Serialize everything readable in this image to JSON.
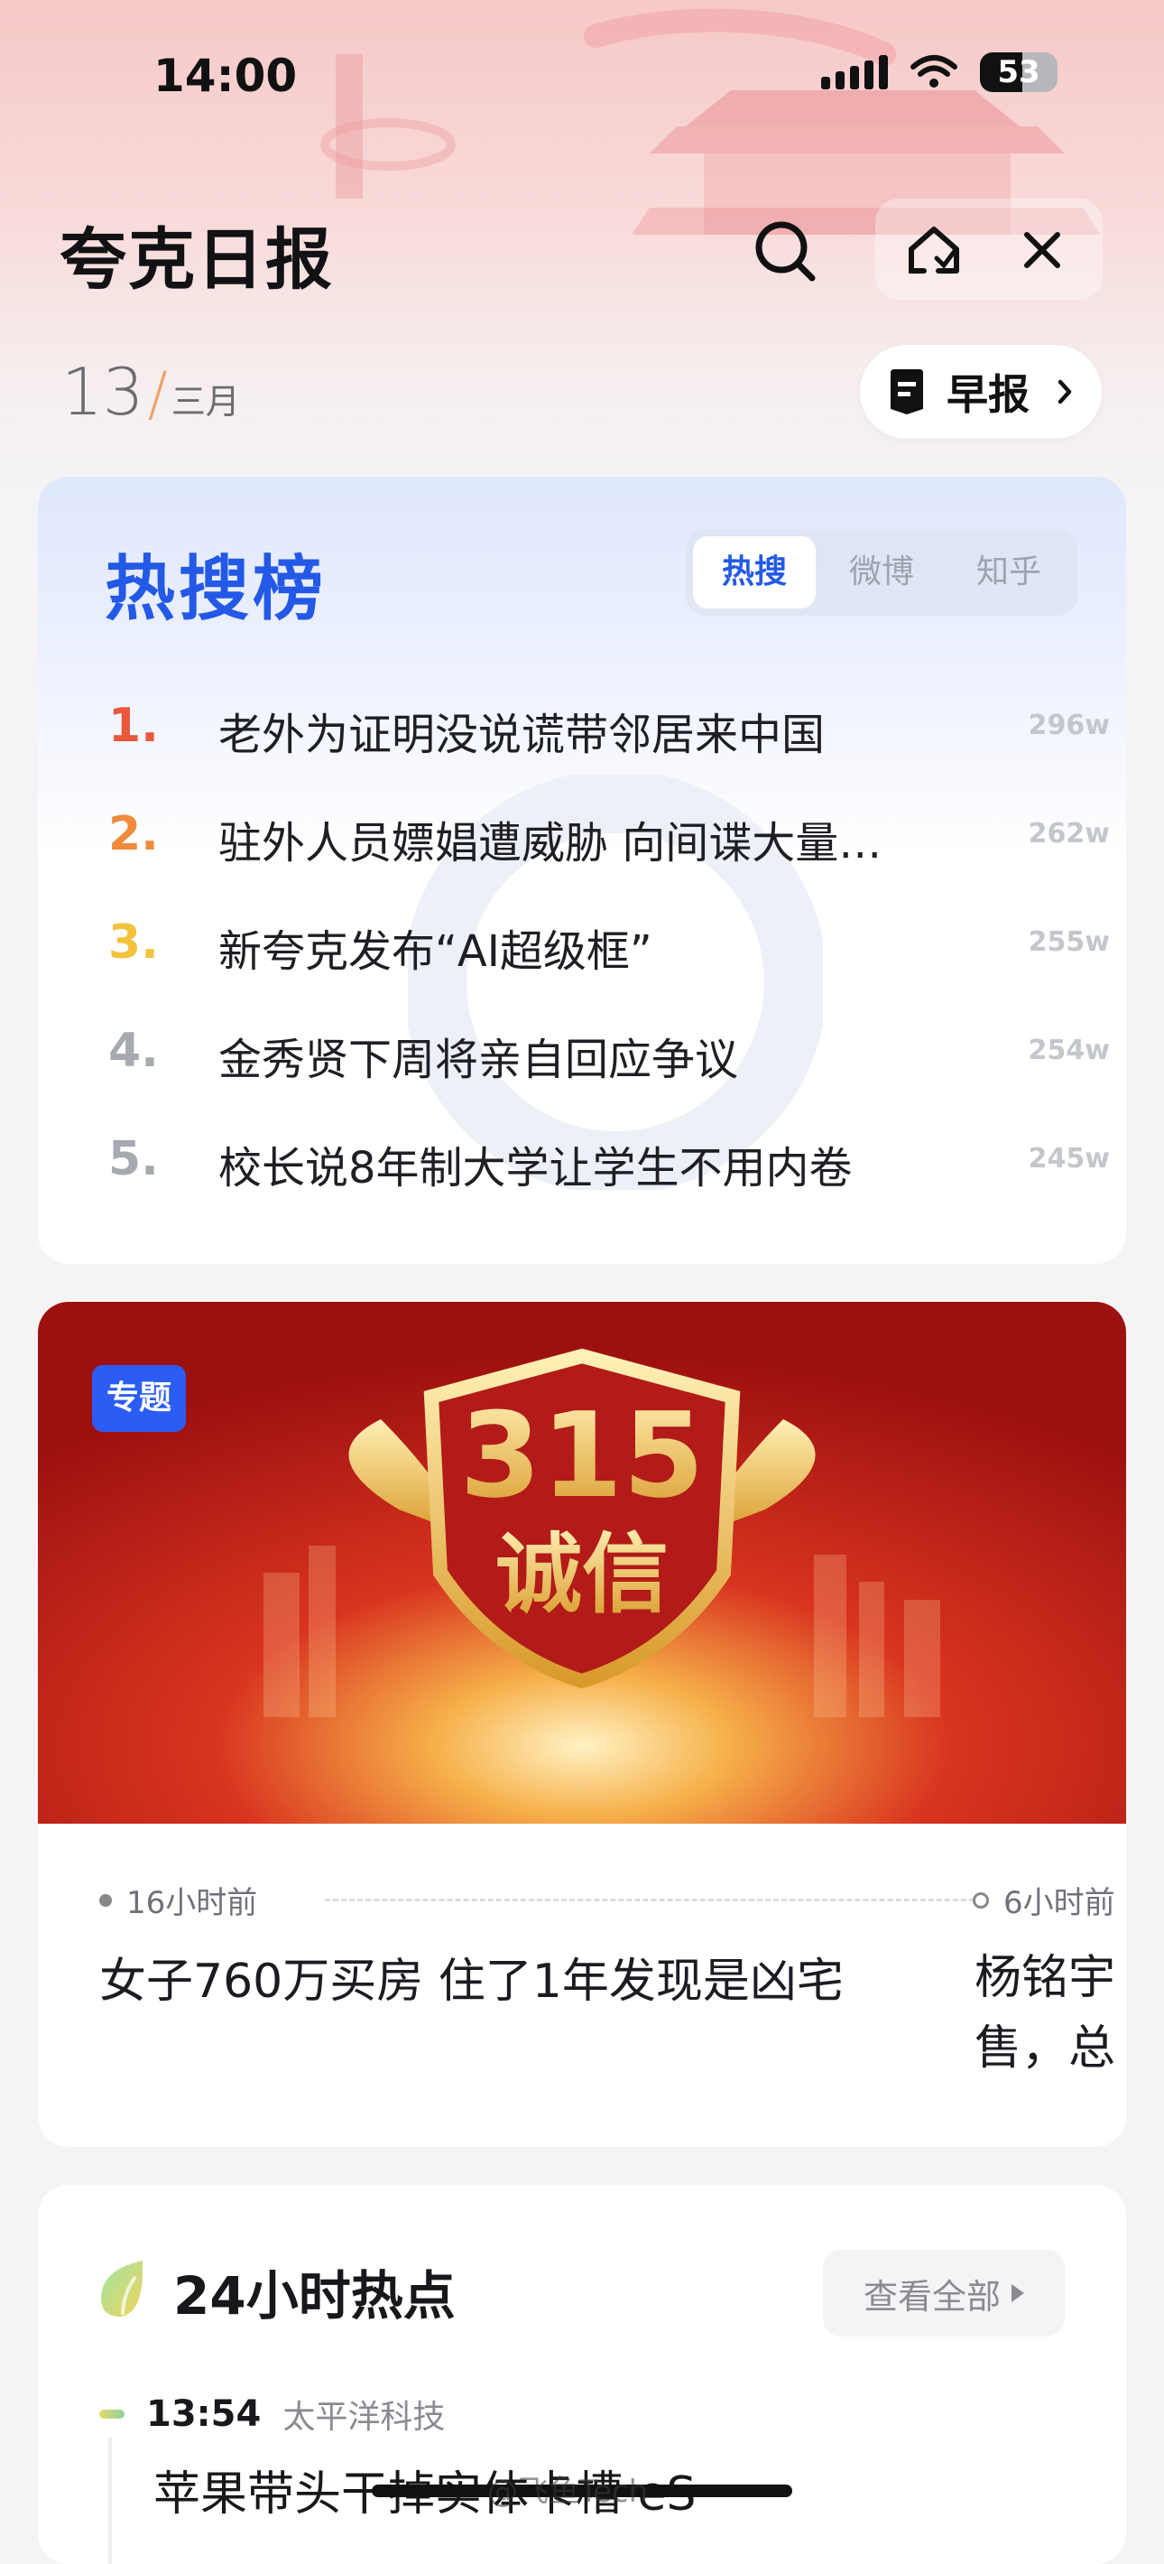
{
  "status_bar": {
    "time": "14:00",
    "battery": "53"
  },
  "header": {
    "title": "夸克日报"
  },
  "date": {
    "day": "13",
    "separator": "/",
    "month": "三月"
  },
  "morning_report": {
    "label": "早报"
  },
  "hot_search": {
    "title": "热搜榜",
    "tabs": [
      {
        "label": "热搜",
        "active": true
      },
      {
        "label": "微博",
        "active": false
      },
      {
        "label": "知乎",
        "active": false
      }
    ],
    "items": [
      {
        "rank": "1.",
        "text": "老外为证明没说谎带邻居来中国",
        "count": "296w",
        "rank_color": "#e9573c"
      },
      {
        "rank": "2.",
        "text": "驻外人员嫖娼遭威胁 向间谍大量…",
        "count": "262w",
        "rank_color": "#f08a3c"
      },
      {
        "rank": "3.",
        "text": "新夸克发布“AI超级框”",
        "count": "255w",
        "rank_color": "#f4c23d"
      },
      {
        "rank": "4.",
        "text": "金秀贤下周将亲自回应争议",
        "count": "254w",
        "rank_color": "#a7a9b0"
      },
      {
        "rank": "5.",
        "text": "校长说8年制大学让学生不用内卷",
        "count": "245w",
        "rank_color": "#a7a9b0"
      }
    ]
  },
  "topic": {
    "badge": "专题",
    "banner_number": "315",
    "banner_word": "诚信",
    "news": [
      {
        "time": "16小时前",
        "title": "女子760万买房 住了1年发现是凶宅"
      },
      {
        "time": "6小时前",
        "title_line1": "杨铭宇",
        "title_line2": "售，总"
      }
    ]
  },
  "hot24": {
    "title": "24小时热点",
    "view_all": "查看全部",
    "item": {
      "time": "13:54",
      "source": "太平洋科技",
      "title": "苹果带头干掉实体卡槽 eS"
    }
  },
  "watermark_text": "@飞鱼Tech",
  "colors": {
    "accent_blue": "#2359e6",
    "badge_blue": "#2b5cf3"
  }
}
